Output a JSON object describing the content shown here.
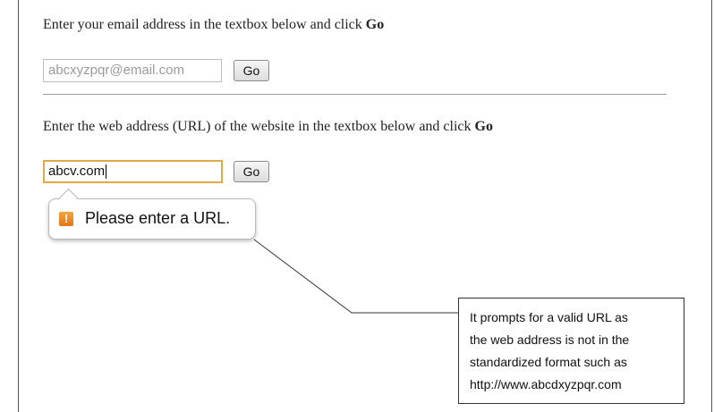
{
  "email_section": {
    "prompt_text": "Enter your email address in the textbox below and click ",
    "prompt_bold": "Go",
    "input_placeholder": "abcxyzpqr@email.com",
    "button_label": "Go"
  },
  "url_section": {
    "prompt_text": "Enter the web address (URL) of the website in the textbox below and click ",
    "prompt_bold": "Go",
    "input_value": "abcv.com",
    "button_label": "Go"
  },
  "validation_tooltip": {
    "icon": "warning-icon",
    "icon_glyph": "!",
    "message": "Please enter a URL.",
    "icon_color": "#e8871e"
  },
  "annotation": {
    "lines": [
      "It prompts for a valid URL as",
      "the web address is not in the",
      "standardized format such as",
      "http://www.abcdxyzpqr.com"
    ]
  },
  "colors": {
    "focus_border": "#e2a94a",
    "placeholder_text": "#9a9a9a"
  }
}
